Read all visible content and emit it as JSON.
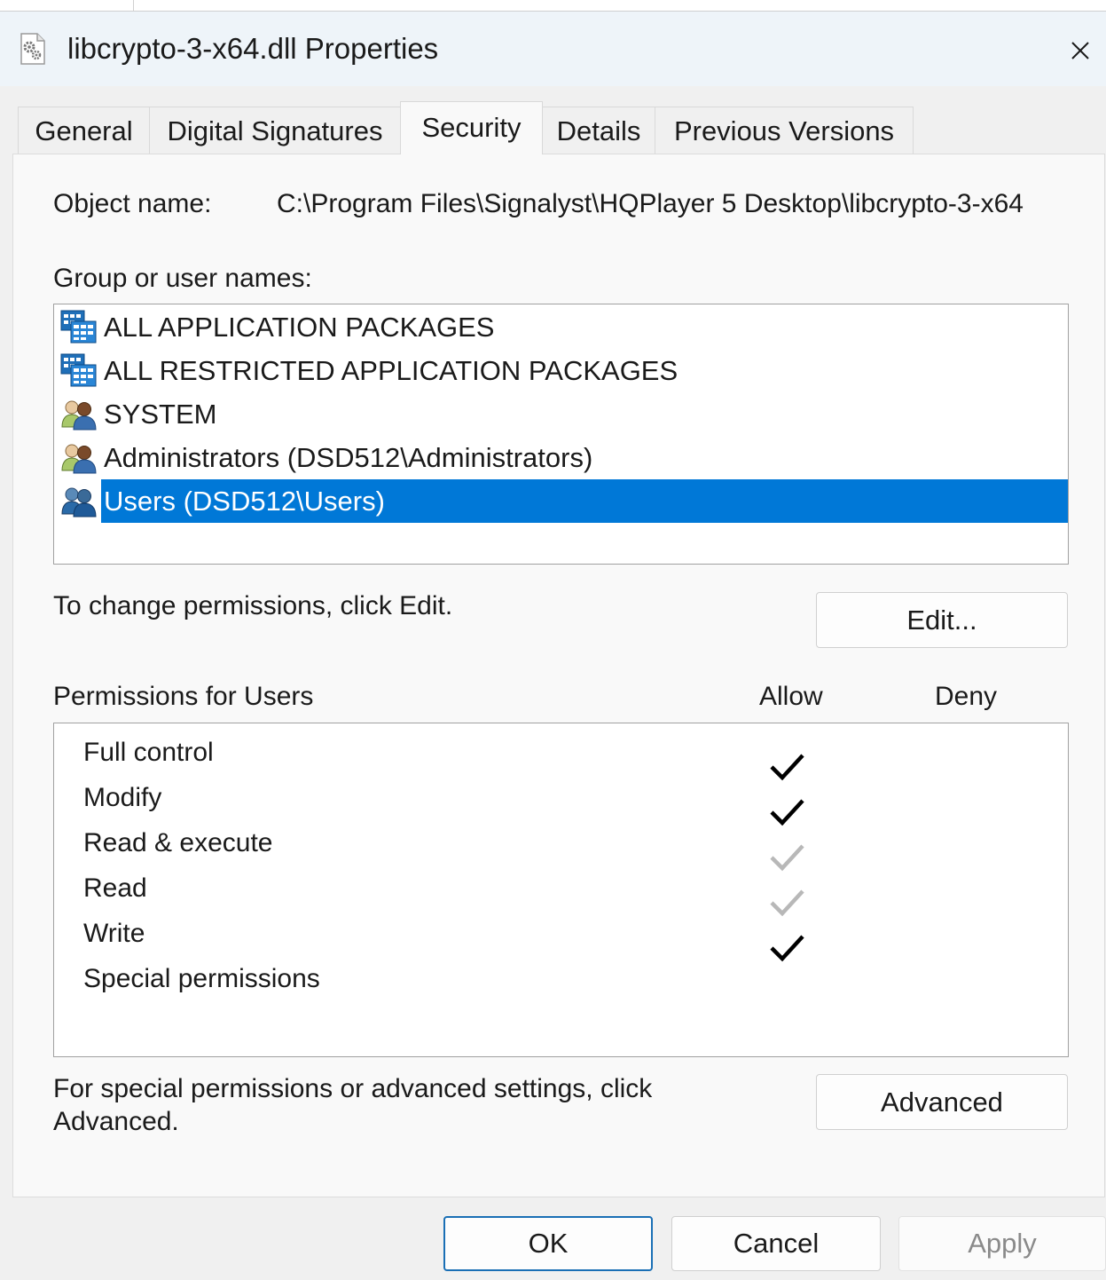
{
  "window": {
    "title": "libcrypto-3-x64.dll Properties",
    "title_icon": "dll-gear-file-icon",
    "close_icon": "close-icon"
  },
  "tabs": [
    {
      "label": "General",
      "active": false
    },
    {
      "label": "Digital Signatures",
      "active": false
    },
    {
      "label": "Security",
      "active": true
    },
    {
      "label": "Details",
      "active": false
    },
    {
      "label": "Previous Versions",
      "active": false
    }
  ],
  "security": {
    "object_name_label": "Object name:",
    "object_name_value": "C:\\Program Files\\Signalyst\\HQPlayer 5 Desktop\\libcrypto-3-x64",
    "group_label": "Group or user names:",
    "groups": [
      {
        "name": "ALL APPLICATION PACKAGES",
        "icon": "app-packages-icon",
        "selected": false
      },
      {
        "name": "ALL RESTRICTED APPLICATION PACKAGES",
        "icon": "app-packages-icon",
        "selected": false
      },
      {
        "name": "SYSTEM",
        "icon": "users-group-icon",
        "selected": false
      },
      {
        "name": "Administrators (DSD512\\Administrators)",
        "icon": "users-group-icon",
        "selected": false
      },
      {
        "name": "Users (DSD512\\Users)",
        "icon": "users-group-blue-icon",
        "selected": true
      }
    ],
    "change_hint": "To change permissions, click Edit.",
    "edit_button": "Edit...",
    "permissions_label": "Permissions for Users",
    "allow_header": "Allow",
    "deny_header": "Deny",
    "permissions": [
      {
        "name": "Full control",
        "allow": "checked",
        "deny": "none"
      },
      {
        "name": "Modify",
        "allow": "checked",
        "deny": "none"
      },
      {
        "name": "Read & execute",
        "allow": "inherited",
        "deny": "none"
      },
      {
        "name": "Read",
        "allow": "inherited",
        "deny": "none"
      },
      {
        "name": "Write",
        "allow": "checked",
        "deny": "none"
      },
      {
        "name": "Special permissions",
        "allow": "none",
        "deny": "none"
      }
    ],
    "advanced_hint_line1": "For special permissions or advanced settings, click",
    "advanced_hint_line2": "Advanced.",
    "advanced_button": "Advanced"
  },
  "footer": {
    "ok": "OK",
    "cancel": "Cancel",
    "apply": "Apply",
    "apply_enabled": false
  },
  "colors": {
    "selection": "#0078d7",
    "check_active": "#000000",
    "check_inherited": "#b8b8b8"
  }
}
